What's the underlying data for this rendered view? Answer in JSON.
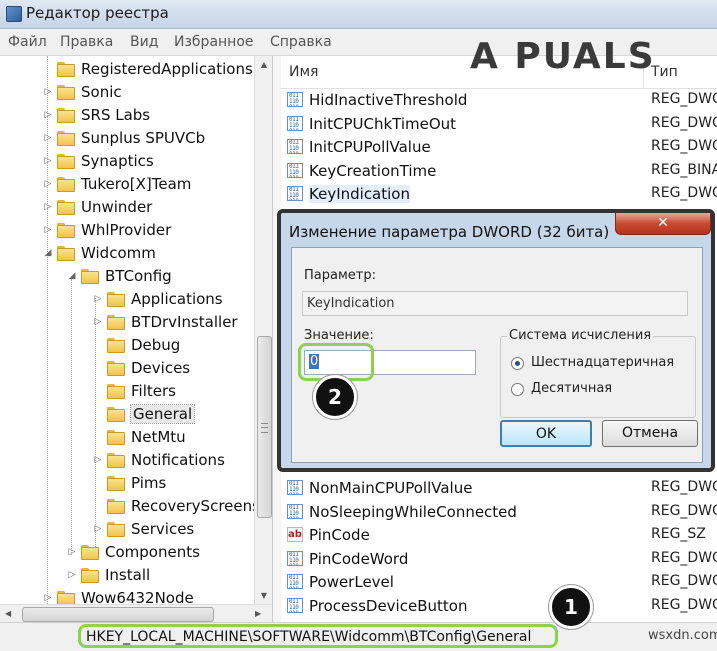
{
  "window": {
    "title": "Редактор реестра"
  },
  "menu": [
    "Файл",
    "Правка",
    "Вид",
    "Избранное",
    "Справка"
  ],
  "tree": {
    "items": [
      {
        "label": "RegisteredApplications",
        "level": 0,
        "expander": ""
      },
      {
        "label": "Sonic",
        "level": 0,
        "expander": "▷"
      },
      {
        "label": "SRS Labs",
        "level": 0,
        "expander": "▷"
      },
      {
        "label": "Sunplus SPUVCb",
        "level": 0,
        "expander": "▷"
      },
      {
        "label": "Synaptics",
        "level": 0,
        "expander": "▷"
      },
      {
        "label": "Tukero[X]Team",
        "level": 0,
        "expander": "▷"
      },
      {
        "label": "Unwinder",
        "level": 0,
        "expander": "▷"
      },
      {
        "label": "WhlProvider",
        "level": 0,
        "expander": "▷"
      },
      {
        "label": "Widcomm",
        "level": 0,
        "expander": "◢"
      },
      {
        "label": "BTConfig",
        "level": 1,
        "expander": "◢"
      },
      {
        "label": "Applications",
        "level": 2,
        "expander": "▷"
      },
      {
        "label": "BTDrvInstaller",
        "level": 2,
        "expander": "▷"
      },
      {
        "label": "Debug",
        "level": 2,
        "expander": ""
      },
      {
        "label": "Devices",
        "level": 2,
        "expander": ""
      },
      {
        "label": "Filters",
        "level": 2,
        "expander": ""
      },
      {
        "label": "General",
        "level": 2,
        "expander": "",
        "selected": true
      },
      {
        "label": "NetMtu",
        "level": 2,
        "expander": ""
      },
      {
        "label": "Notifications",
        "level": 2,
        "expander": "▷"
      },
      {
        "label": "Pims",
        "level": 2,
        "expander": ""
      },
      {
        "label": "RecoveryScreens",
        "level": 2,
        "expander": ""
      },
      {
        "label": "Services",
        "level": 2,
        "expander": "▷"
      },
      {
        "label": "Components",
        "level": 1,
        "expander": "▷"
      },
      {
        "label": "Install",
        "level": 1,
        "expander": "▷"
      },
      {
        "label": "Wow6432Node",
        "level": 0,
        "expander": "▷"
      }
    ]
  },
  "list": {
    "col_name": "Имя",
    "col_type": "Тип",
    "top_rows": [
      {
        "name": "HidInactiveThreshold",
        "type": "REG_DWO",
        "icon": "dword-icon"
      },
      {
        "name": "InitCPUChkTimeOut",
        "type": "REG_DWO",
        "icon": "dword-icon"
      },
      {
        "name": "InitCPUPollValue",
        "type": "REG_DWO",
        "icon": "dword-icon"
      },
      {
        "name": "KeyCreationTime",
        "type": "REG_BINA",
        "icon": "dword-icon"
      },
      {
        "name": "KeyIndication",
        "type": "REG_DWO",
        "icon": "dword-icon",
        "highlight": true
      }
    ],
    "bottom_rows": [
      {
        "name": "NonMainCPUPollValue",
        "type": "REG_DWO",
        "icon": "dword-icon"
      },
      {
        "name": "NoSleepingWhileConnected",
        "type": "REG_DWO",
        "icon": "dword-icon"
      },
      {
        "name": "PinCode",
        "type": "REG_SZ",
        "icon": "string-icon"
      },
      {
        "name": "PinCodeWord",
        "type": "REG_DWO",
        "icon": "dword-icon"
      },
      {
        "name": "PowerLevel",
        "type": "REG_DWO",
        "icon": "dword-icon"
      },
      {
        "name": "ProcessDeviceButton",
        "type": "REG_DWO",
        "icon": "dword-icon"
      }
    ]
  },
  "dialog": {
    "title": "Изменение параметра DWORD (32 бита)",
    "close_label": "✕",
    "param_label": "Параметр:",
    "param_value": "KeyIndication",
    "value_label": "Значение:",
    "value_text": "0",
    "base_group_title": "Система исчисления",
    "radio_hex": "Шестнадцатеричная",
    "radio_dec": "Десятичная",
    "ok_label": "OK",
    "cancel_label": "Отмена"
  },
  "status": {
    "path": "HKEY_LOCAL_MACHINE\\SOFTWARE\\Widcomm\\BTConfig\\General"
  },
  "watermark": {
    "text": "A PUALS",
    "site": "wsxdn.com"
  },
  "badges": {
    "one": "1",
    "two": "2"
  },
  "colors": {
    "highlight_ring": "#8fd14f",
    "selection": "#3b73c8",
    "close_button": "#c84b31",
    "dialog_frame": "#c6d7ea"
  }
}
